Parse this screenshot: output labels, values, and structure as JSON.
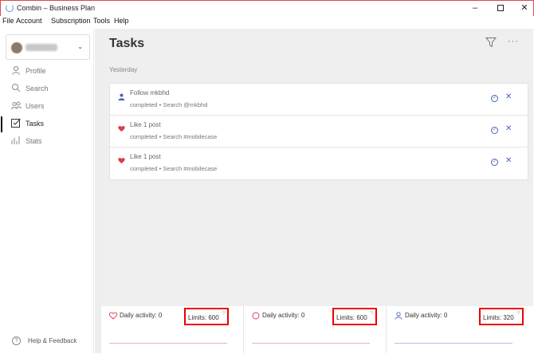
{
  "window": {
    "title": "Combin – Business Plan",
    "minimize": "–",
    "close": "✕"
  },
  "menu": [
    "File",
    "Account",
    "Subscription",
    "Tools",
    "Help"
  ],
  "sidebar": {
    "account_chevron": "⌄",
    "items": [
      {
        "label": "Profile",
        "icon": "person-icon",
        "glyph": "⚲"
      },
      {
        "label": "Search",
        "icon": "search-icon",
        "glyph": "○"
      },
      {
        "label": "Users",
        "icon": "users-icon",
        "glyph": "ℵ"
      },
      {
        "label": "Tasks",
        "icon": "tasks-icon",
        "glyph": "☑"
      },
      {
        "label": "Stats",
        "icon": "stats-icon",
        "glyph": "ılı"
      }
    ],
    "active": "Tasks",
    "help_label": "Help & Feedback",
    "help_glyph": "?"
  },
  "main": {
    "title": "Tasks",
    "more": "···",
    "group": "Yesterday",
    "tasks": [
      {
        "name": "Follow mkbhd",
        "meta": "completed • Search @mkbhd",
        "icon": "user-icon"
      },
      {
        "name": "Like 1 post",
        "meta": "completed • Search #mobilecase",
        "icon": "heart-icon"
      },
      {
        "name": "Like 1 post",
        "meta": "completed • Search #mobilecase",
        "icon": "heart-icon"
      }
    ],
    "check_glyph": "✓",
    "remove_glyph": "✕"
  },
  "stats": [
    {
      "label": "Daily activity: 0",
      "limits": "Limits: 600",
      "sup": "?",
      "icon": "heart-outline-icon"
    },
    {
      "label": "Daily activity: 0",
      "limits": "Limits: 600",
      "sup": "?",
      "icon": "comment-icon"
    },
    {
      "label": "Daily activity: 0",
      "limits": "Limits: 320",
      "sup": "?",
      "icon": "user-outline-icon"
    }
  ],
  "colors": {
    "accent": "#4a62c4",
    "heart": "#e0394b",
    "highlight_box": "#e00000"
  }
}
